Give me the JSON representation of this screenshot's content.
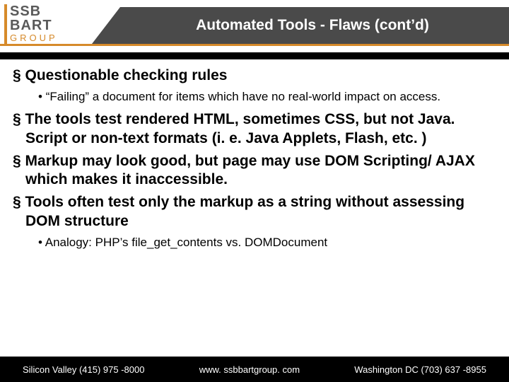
{
  "logo": {
    "line1a": "SSB",
    "line1b": "BART",
    "line2": "GROUP"
  },
  "title": "Automated Tools  - Flaws (cont’d)",
  "bullets": [
    {
      "level": 1,
      "text": "Questionable checking rules"
    },
    {
      "level": 2,
      "text": "“Failing” a document for items which have no real-world impact on access."
    },
    {
      "level": 1,
      "text": "The tools test rendered HTML, sometimes CSS, but not Java. Script or non-text formats (i. e. Java Applets, Flash, etc. )"
    },
    {
      "level": 1,
      "text": "Markup may look good, but page may use DOM Scripting/ AJAX which makes it inaccessible."
    },
    {
      "level": 1,
      "text": "Tools often test only the markup as a string without assessing DOM structure"
    },
    {
      "level": 2,
      "text": "Analogy:  PHP’s file_get_contents vs. DOMDocument"
    }
  ],
  "footer": {
    "left": "Silicon Valley (415) 975 -8000",
    "center": "www. ssbbartgroup. com",
    "right": "Washington DC (703) 637 -8955"
  }
}
